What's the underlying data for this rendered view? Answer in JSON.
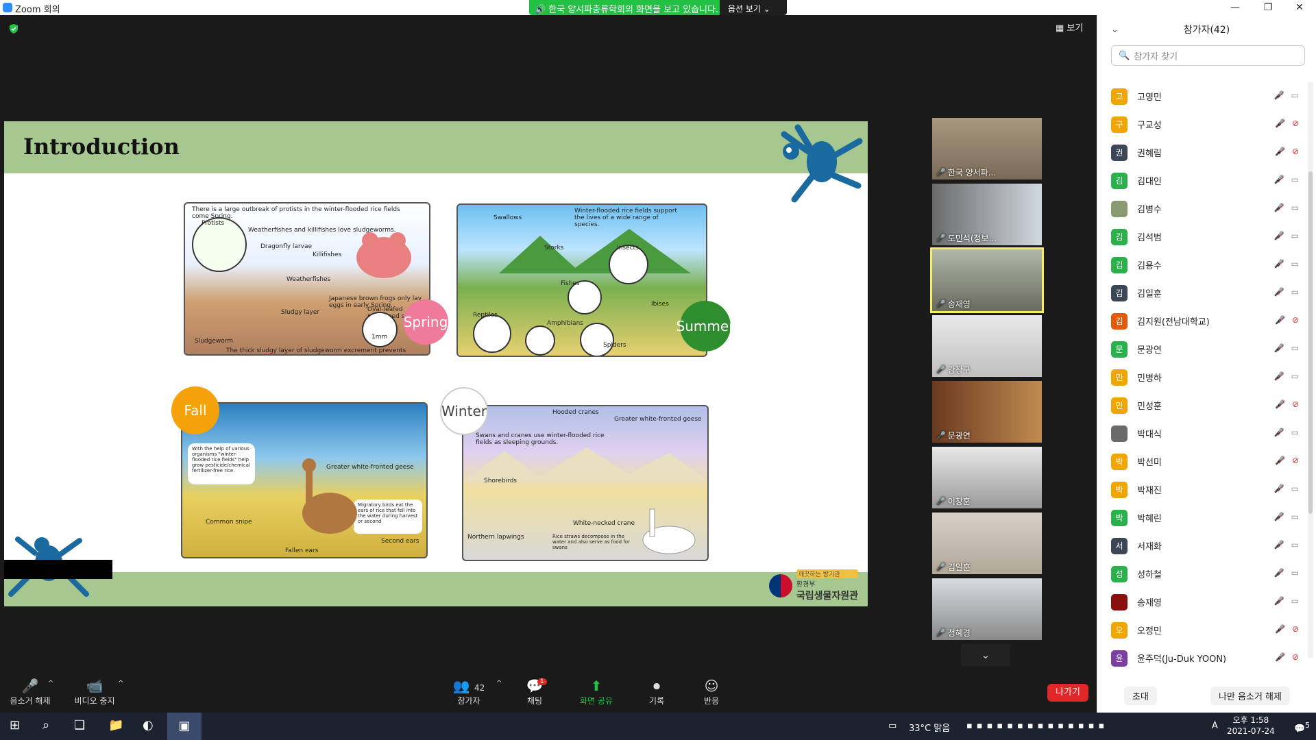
{
  "window": {
    "title": "Zoom 회의",
    "share_banner": "한국 양서파충류학회의 화면을 보고 있습니다.",
    "view_options": "옵션 보기 ⌄",
    "view_btn": "보기"
  },
  "slide": {
    "title": "Introduction",
    "seasons": [
      "Spring",
      "Summer",
      "Fall",
      "Winter"
    ],
    "spring": {
      "caption": "There is a large outbreak of protists in the winter-flooded rice fields come Spring.",
      "labels": [
        "Protists",
        "Weatherfishes and killifishes love sludgeworms.",
        "Dragonfly larvae",
        "Killifishes",
        "Weatherfishes",
        "Japanese brown frogs only lay eggs in early Spring.",
        "Sludgy layer",
        "Oval-leafed pondweed seeds",
        "Sludgeworm",
        "The thick sludgy layer of sludgeworm excrement prevents weeds from growing.",
        "1mm"
      ]
    },
    "summer": {
      "caption": "Winter-flooded rice fields support the lives of a wide range of species.",
      "labels": [
        "Swallows",
        "Storks",
        "Insects",
        "Fishes",
        "Ibises",
        "Reptiles",
        "Amphibians",
        "Spiders"
      ]
    },
    "fall": {
      "caption": "With the help of various organisms \"winter-flooded rice fields\" help grow pesticide/chemical fertilizer-free rice.",
      "labels": [
        "Greater white-fronted geese",
        "Migratory birds eat the ears of rice that fell into the water during harvest or second",
        "Common snipe",
        "Fallen ears",
        "Second ears"
      ]
    },
    "winter": {
      "caption": "Swans and cranes use winter-flooded rice fields as sleeping grounds.",
      "labels": [
        "Hooded cranes",
        "Greater white-fronted geese",
        "Shorebirds",
        "White-necked crane",
        "Northern lapwings",
        "Rice straws decompose in the water and also serve as food for swans"
      ]
    },
    "agency": {
      "ministry": "환경부",
      "name": "국립생물자원관",
      "tag": "깨끗하는 방기관"
    }
  },
  "gallery": [
    {
      "name": "한국 양서파..."
    },
    {
      "name": "도민석(정보..."
    },
    {
      "name": "송재영"
    },
    {
      "name": "강창구"
    },
    {
      "name": "문광연"
    },
    {
      "name": "이창훈"
    },
    {
      "name": "김일훈"
    },
    {
      "name": "정혜경"
    }
  ],
  "toolbar": {
    "unmute": "음소거 해제",
    "stop_video": "비디오 중지",
    "participants": "참가자",
    "participants_count": "42",
    "chat": "채팅",
    "chat_badge": "1",
    "share": "화면 공유",
    "record": "기록",
    "reactions": "반응",
    "leave": "나가기"
  },
  "participants_panel": {
    "title": "참가자(42)",
    "search_placeholder": "참가자 찾기",
    "invite": "초대",
    "unmute_me": "나만 음소거 해제",
    "people": [
      {
        "initial": "고",
        "name": "고영민",
        "color": "#f0a500",
        "cam_off": false
      },
      {
        "initial": "구",
        "name": "구교성",
        "color": "#f0a500",
        "cam_off": true
      },
      {
        "initial": "권",
        "name": "권혜림",
        "color": "#3b4656",
        "cam_off": true
      },
      {
        "initial": "김",
        "name": "김대인",
        "color": "#2bb14c",
        "cam_off": false
      },
      {
        "initial": "",
        "name": "김병수",
        "color": "#8a9a70",
        "cam_off": false
      },
      {
        "initial": "김",
        "name": "김석범",
        "color": "#2bb14c",
        "cam_off": false
      },
      {
        "initial": "김",
        "name": "김용수",
        "color": "#2bb14c",
        "cam_off": false
      },
      {
        "initial": "김",
        "name": "김일훈",
        "color": "#3b4656",
        "cam_off": false
      },
      {
        "initial": "김",
        "name": "김지원(전남대학교)",
        "color": "#e25a0e",
        "cam_off": true
      },
      {
        "initial": "문",
        "name": "문광연",
        "color": "#2bb14c",
        "cam_off": false
      },
      {
        "initial": "민",
        "name": "민병하",
        "color": "#f0a500",
        "cam_off": false
      },
      {
        "initial": "민",
        "name": "민성훈",
        "color": "#f0a500",
        "cam_off": true
      },
      {
        "initial": "",
        "name": "박대식",
        "color": "#6a6a6a",
        "cam_off": false
      },
      {
        "initial": "박",
        "name": "박선미",
        "color": "#f0a500",
        "cam_off": true
      },
      {
        "initial": "박",
        "name": "박재진",
        "color": "#f0a500",
        "cam_off": false
      },
      {
        "initial": "박",
        "name": "박혜린",
        "color": "#2bb14c",
        "cam_off": false
      },
      {
        "initial": "서",
        "name": "서재화",
        "color": "#3b4656",
        "cam_off": false
      },
      {
        "initial": "성",
        "name": "성하철",
        "color": "#2bb14c",
        "cam_off": false
      },
      {
        "initial": "",
        "name": "송재영",
        "color": "#8a1010",
        "cam_off": false
      },
      {
        "initial": "오",
        "name": "오정민",
        "color": "#f0a500",
        "cam_off": true
      },
      {
        "initial": "윤",
        "name": "윤주덕(Ju-Duk YOON)",
        "color": "#7a3fa0",
        "cam_off": true
      }
    ]
  },
  "taskbar": {
    "weather": "33°C 맑음",
    "time": "오후 1:58",
    "date": "2021-07-24",
    "notif": "5"
  }
}
